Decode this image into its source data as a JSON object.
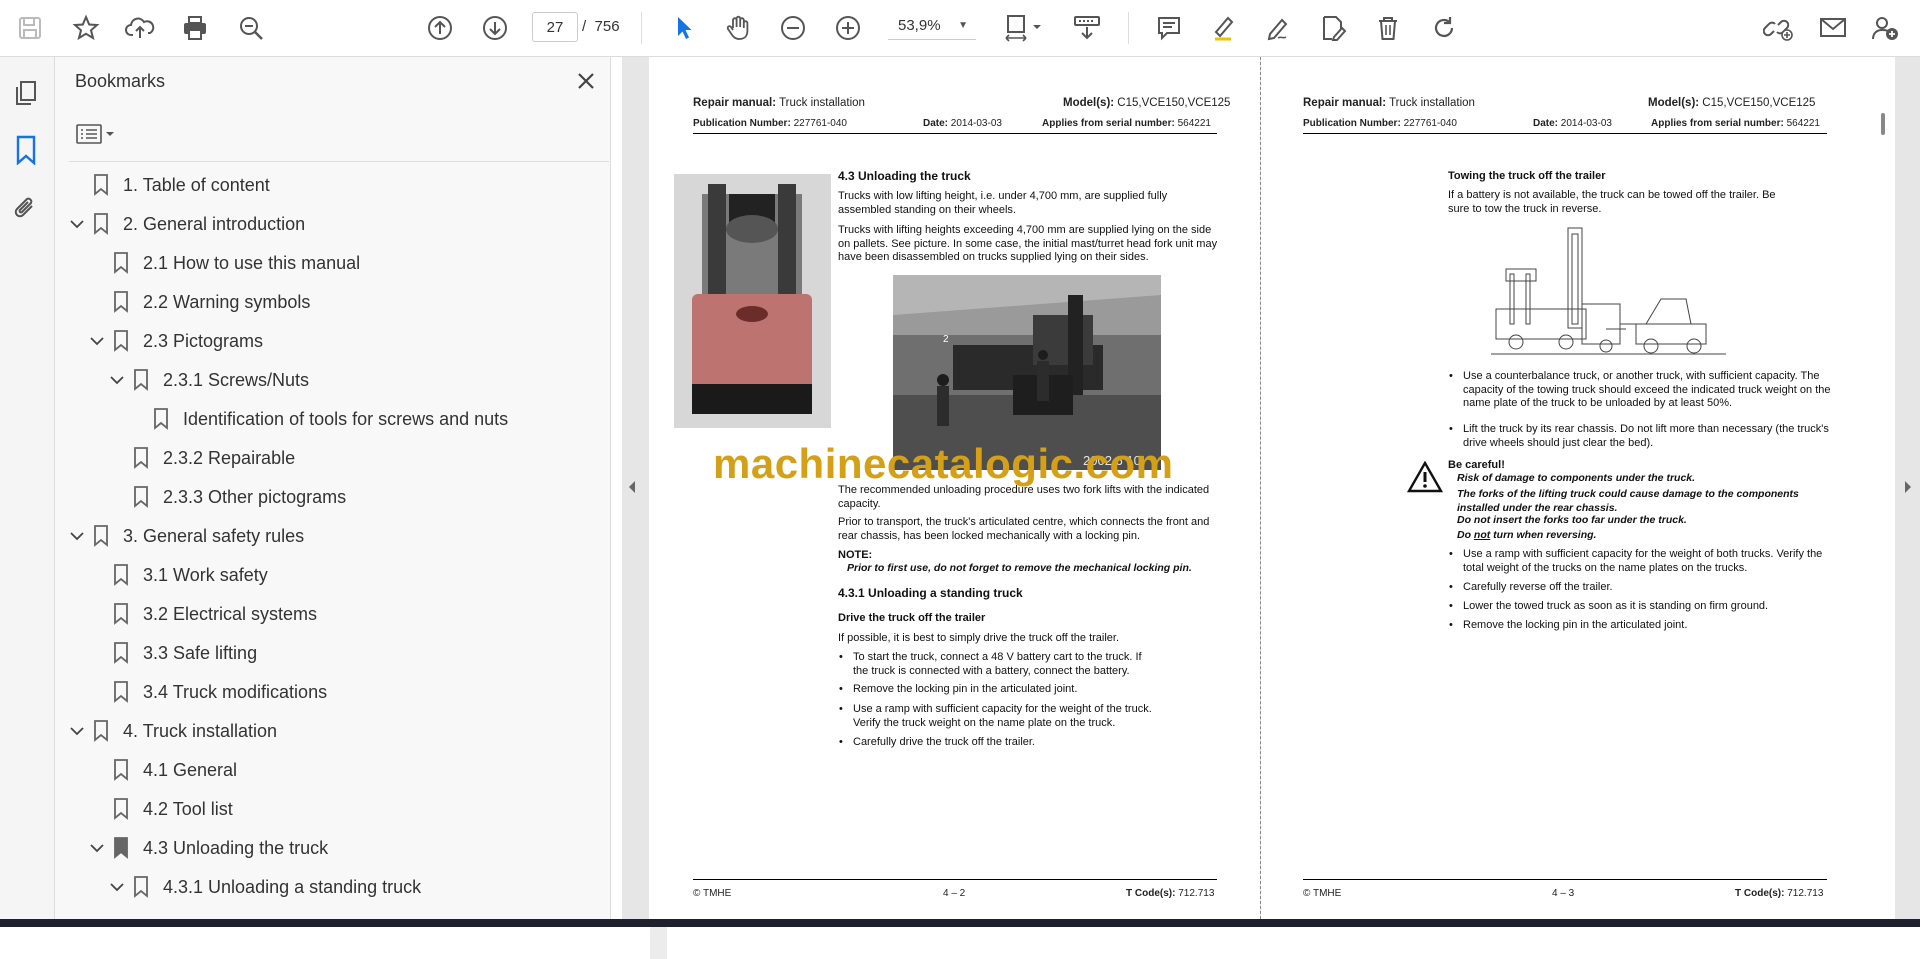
{
  "toolbar": {
    "page_current": "27",
    "page_sep": "/",
    "page_total": "756",
    "zoom": "53,9%"
  },
  "panel": {
    "title": "Bookmarks",
    "bookmarks": [
      {
        "label": "1. Table of content",
        "level": 0,
        "expanded": null
      },
      {
        "label": "2. General introduction",
        "level": 0,
        "expanded": true
      },
      {
        "label": "2.1 How to use this manual",
        "level": 1,
        "expanded": null
      },
      {
        "label": "2.2 Warning symbols",
        "level": 1,
        "expanded": null
      },
      {
        "label": "2.3 Pictograms",
        "level": 1,
        "expanded": true
      },
      {
        "label": "2.3.1 Screws/Nuts",
        "level": 2,
        "expanded": true
      },
      {
        "label": "Identification of tools for screws and nuts",
        "level": 3,
        "expanded": null
      },
      {
        "label": "2.3.2 Repairable",
        "level": 2,
        "expanded": null
      },
      {
        "label": "2.3.3 Other pictograms",
        "level": 2,
        "expanded": null
      },
      {
        "label": "3. General safety rules",
        "level": 0,
        "expanded": true
      },
      {
        "label": "3.1 Work safety",
        "level": 1,
        "expanded": null
      },
      {
        "label": "3.2 Electrical systems",
        "level": 1,
        "expanded": null
      },
      {
        "label": "3.3 Safe lifting",
        "level": 1,
        "expanded": null
      },
      {
        "label": "3.4 Truck modifications",
        "level": 1,
        "expanded": null
      },
      {
        "label": "4. Truck installation",
        "level": 0,
        "expanded": true
      },
      {
        "label": "4.1 General",
        "level": 1,
        "expanded": null
      },
      {
        "label": "4.2 Tool list",
        "level": 1,
        "expanded": null
      },
      {
        "label": "4.3 Unloading the truck",
        "level": 1,
        "expanded": true,
        "current": true
      },
      {
        "label": "4.3.1 Unloading a standing truck",
        "level": 2,
        "expanded": true
      }
    ]
  },
  "page_left": {
    "hdr_repair": "Repair manual:",
    "hdr_repair_val": " Truck installation",
    "hdr_model": "Model(s):",
    "hdr_model_val": " C15,VCE150,VCE125",
    "pub_label": "Publication Number:",
    "pub_val": " 227761-040",
    "date_label": "Date:",
    "date_val": " 2014-03-03",
    "serial_label": "Applies from serial number:",
    "serial_val": " 564221",
    "h43": "4.3 Unloading the truck",
    "p1": "Trucks with low lifting height, i.e. under 4,700 mm, are supplied fully assembled standing on their wheels.",
    "p2": "Trucks with lifting heights exceeding 4,700 mm are supplied lying on the side on pallets. See picture. In some case, the initial mast/turret head fork unit may have been disassembled on trucks supplied lying on their sides.",
    "photo_num": "2",
    "photo_date": "2002 6 10",
    "p3": "The recommended unloading procedure uses two fork lifts with the indicated capacity.",
    "p4": "Prior to transport, the truck's articulated centre, which connects the front and rear chassis, has been locked mechanically with a locking pin.",
    "note_label": "NOTE:",
    "note_text": "Prior to first use, do not forget to remove the mechanical locking pin.",
    "h431": "4.3.1 Unloading a standing truck",
    "h_drive": "Drive the truck off the trailer",
    "p5": "If possible, it is best to simply drive the truck off the trailer.",
    "b1": "To start the truck, connect a 48 V battery cart to the truck. If the truck is connected with a battery, connect the battery.",
    "b2": "Remove the locking pin in the articulated joint.",
    "b3": "Use a ramp with sufficient capacity for the weight of the truck. Verify the truck weight on the name plate on the truck.",
    "b4": "Carefully drive the truck off the trailer.",
    "foot_left": "© TMHE",
    "foot_mid": "4 – 2",
    "foot_tcode": "T Code(s):",
    "foot_tcode_val": " 712.713"
  },
  "page_right": {
    "hdr_repair": "Repair manual:",
    "hdr_repair_val": " Truck installation",
    "hdr_model": "Model(s):",
    "hdr_model_val": " C15,VCE150,VCE125",
    "pub_label": "Publication Number:",
    "pub_val": " 227761-040",
    "date_label": "Date:",
    "date_val": " 2014-03-03",
    "serial_label": "Applies from serial number:",
    "serial_val": " 564221",
    "h_tow": "Towing the truck off the trailer",
    "p1": "If a battery is not available, the truck can be towed off the trailer. Be sure to tow the truck in reverse.",
    "b1": "Use a counterbalance truck, or another truck, with sufficient capacity. The capacity of the towing truck should exceed the indicated truck weight on the name plate of the truck to be unloaded by at least 50%.",
    "b2": "Lift the truck by its rear chassis. Do not lift more than necessary (the truck's drive wheels should just clear the bed).",
    "careful": "Be careful!",
    "c1": "Risk of damage to components under the truck.",
    "c2": "The forks of the lifting truck could cause damage to the components installed under the rear chassis.",
    "c3": "Do not insert the forks too far under the truck.",
    "c4_pre": "Do ",
    "c4_not": "not",
    "c4_post": " turn when reversing.",
    "b3": "Use a ramp with sufficient capacity for the weight of both trucks. Verify the total weight of the trucks on the name plates on the trucks.",
    "b4": "Carefully reverse off the trailer.",
    "b5": "Lower the towed truck as soon as it is standing on firm ground.",
    "b6": "Remove the locking pin in the articulated joint.",
    "foot_left": "© TMHE",
    "foot_mid": "4 – 3",
    "foot_tcode": "T Code(s):",
    "foot_tcode_val": " 712.713"
  },
  "watermark": "machinecatalogic.com",
  "colors": {
    "accent": "#1473e6",
    "watermark": "#d4a017"
  }
}
